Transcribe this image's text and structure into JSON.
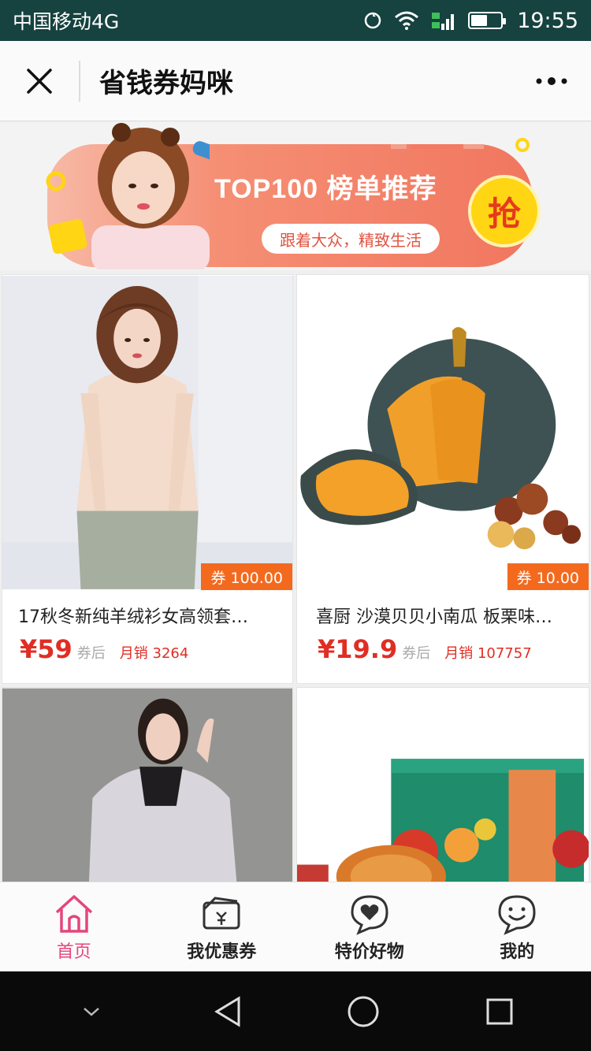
{
  "status_bar": {
    "carrier": "中国移动4G",
    "time": "19:55",
    "battery_level": 0.55
  },
  "navbar": {
    "title": "省钱券妈咪",
    "close_icon": "close-icon",
    "more_icon": "more-dots-icon"
  },
  "banner": {
    "title": "TOP100 榜单推荐",
    "tagline": "跟着大众，精致生活",
    "grab_label": "抢"
  },
  "products": [
    {
      "name": "17秋冬新纯羊绒衫女高领套…",
      "coupon": "券 100.00",
      "price": "¥59",
      "after_label": "券后",
      "sales": "月销 3264",
      "image": "woman-sweater-photo"
    },
    {
      "name": "喜厨 沙漠贝贝小南瓜 板栗味…",
      "coupon": "券 10.00",
      "price": "¥19.9",
      "after_label": "券后",
      "sales": "月销 107757",
      "image": "pumpkin-photo"
    },
    {
      "name": "",
      "image": "woman-coat-photo"
    },
    {
      "name": "",
      "image": "mooncake-gift-box-photo"
    }
  ],
  "tabs": [
    {
      "label": "首页",
      "icon": "home-icon",
      "active": true
    },
    {
      "label": "我优惠券",
      "icon": "coupon-icon",
      "active": false
    },
    {
      "label": "特价好物",
      "icon": "heart-bubble-icon",
      "active": false
    },
    {
      "label": "我的",
      "icon": "profile-icon",
      "active": false
    }
  ],
  "colors": {
    "accent": "#e5467a",
    "price": "#e02e24",
    "coupon_tag": "#f36a1f",
    "status_bar": "#16423f"
  }
}
